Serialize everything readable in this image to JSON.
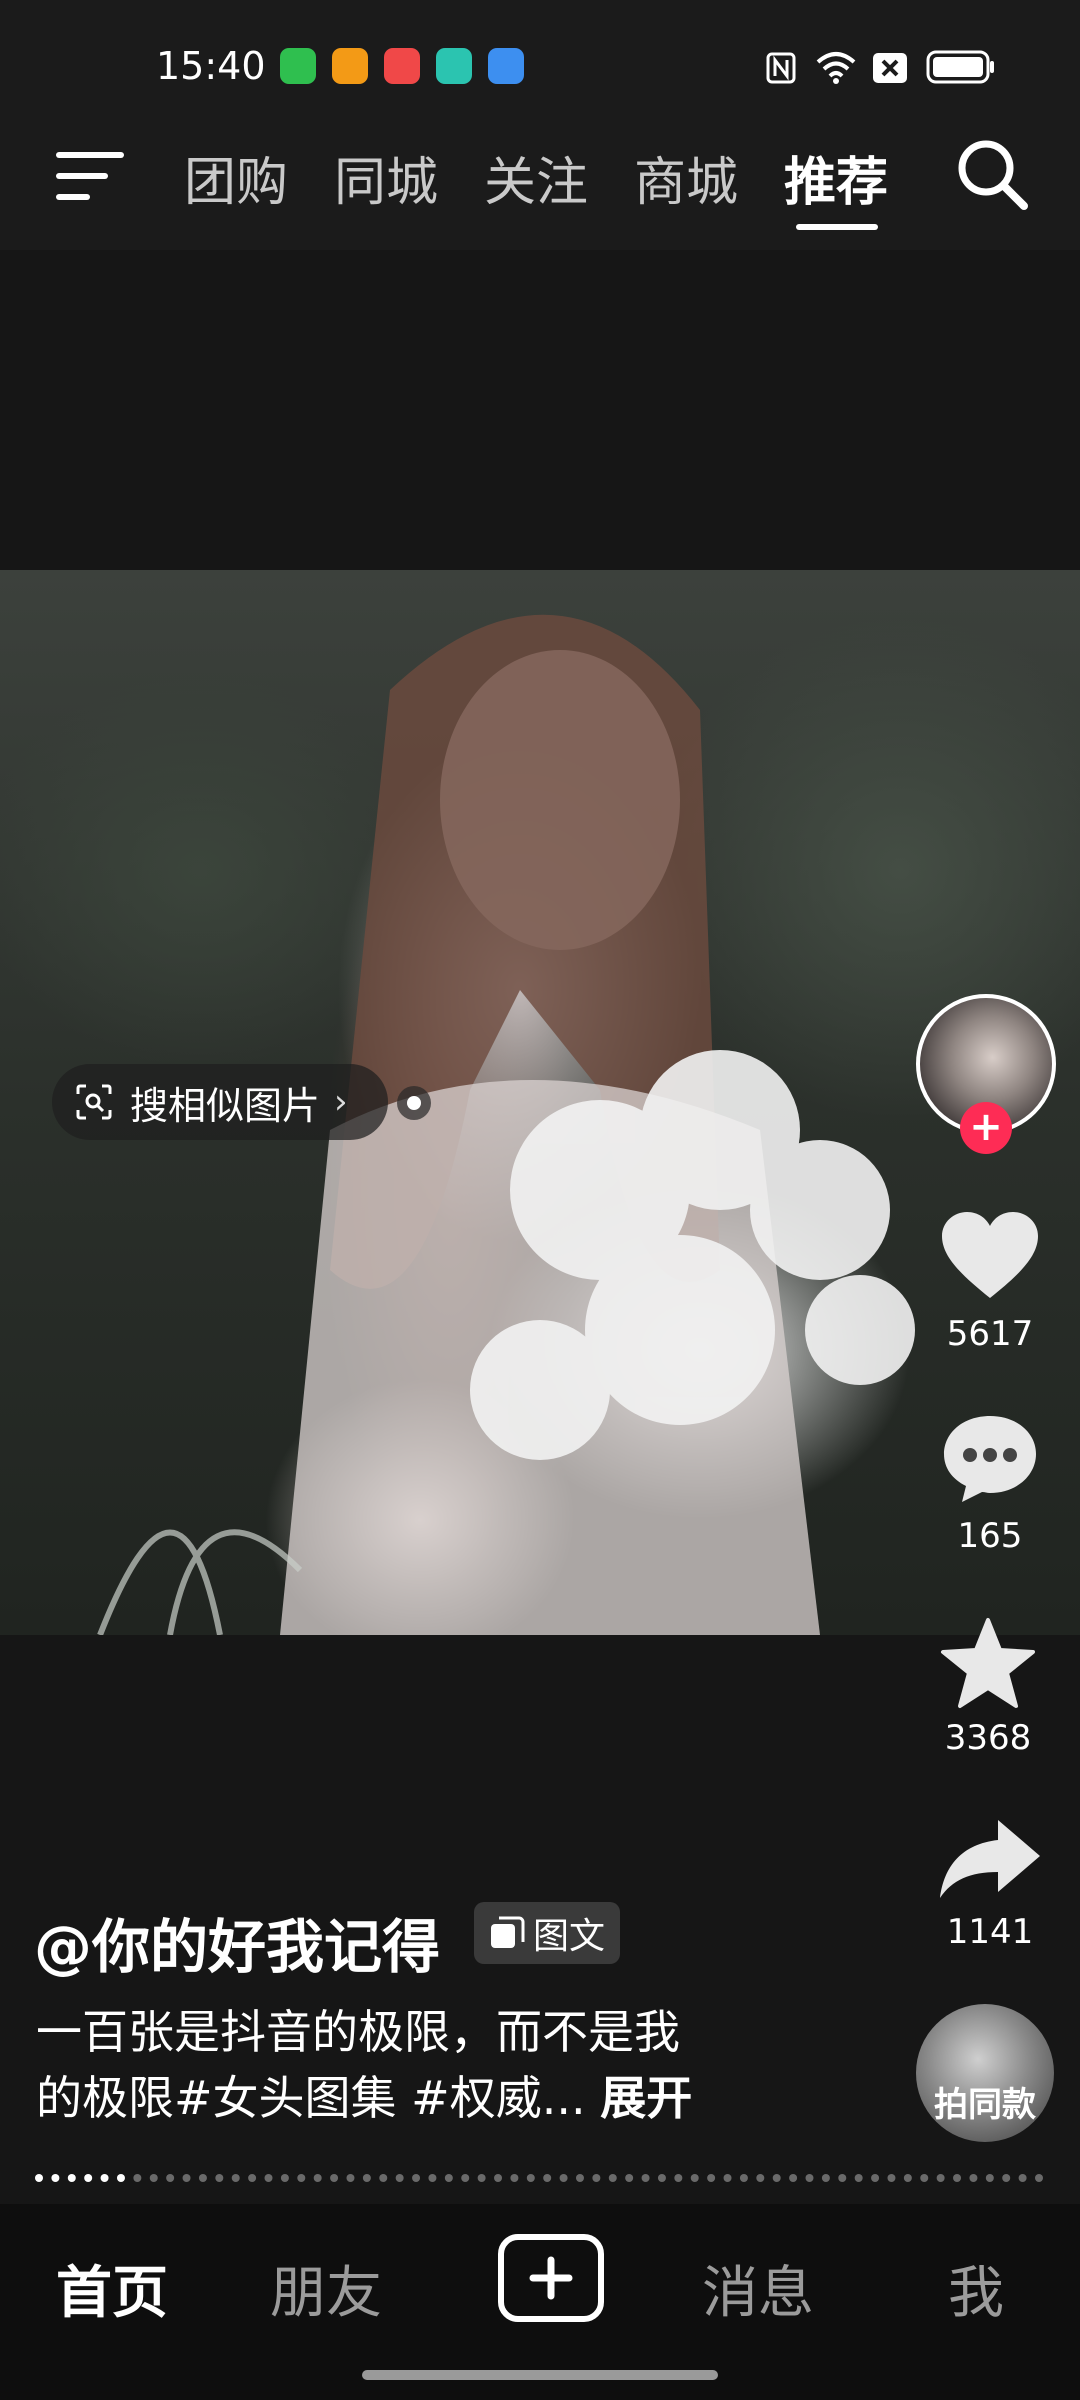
{
  "status_bar": {
    "time": "15:40",
    "apps": [
      {
        "name": "shield-app-icon",
        "color": "#2fbf4f"
      },
      {
        "name": "video-clip-app-icon",
        "color": "#f39a16"
      },
      {
        "name": "play-app-icon",
        "color": "#f04848"
      },
      {
        "name": "chat-app-icon",
        "color": "#2bc4b0"
      },
      {
        "name": "weather-app-icon",
        "color": "#3d8ff0"
      }
    ]
  },
  "top_nav": {
    "tabs": [
      "团购",
      "同城",
      "关注",
      "商城",
      "推荐"
    ],
    "active_tab": "推荐"
  },
  "post": {
    "similar_search": "搜相似图片",
    "author": "@你的好我记得",
    "type_badge": "图文",
    "caption_line1": "一百张是抖音的极限，而不是我",
    "caption_line2": "的极限#女头图集 #权威...",
    "expand": "展开"
  },
  "rail": {
    "likes": "5617",
    "comments": "165",
    "favorites": "3368",
    "shares": "1141",
    "same_style": "拍同款"
  },
  "progress": {
    "total_pages": 62,
    "current_page": 5
  },
  "bottom_nav": {
    "home": "首页",
    "friends": "朋友",
    "messages": "消息",
    "me": "我"
  },
  "colors": {
    "accent": "#fe2c55",
    "background": "#161616"
  }
}
